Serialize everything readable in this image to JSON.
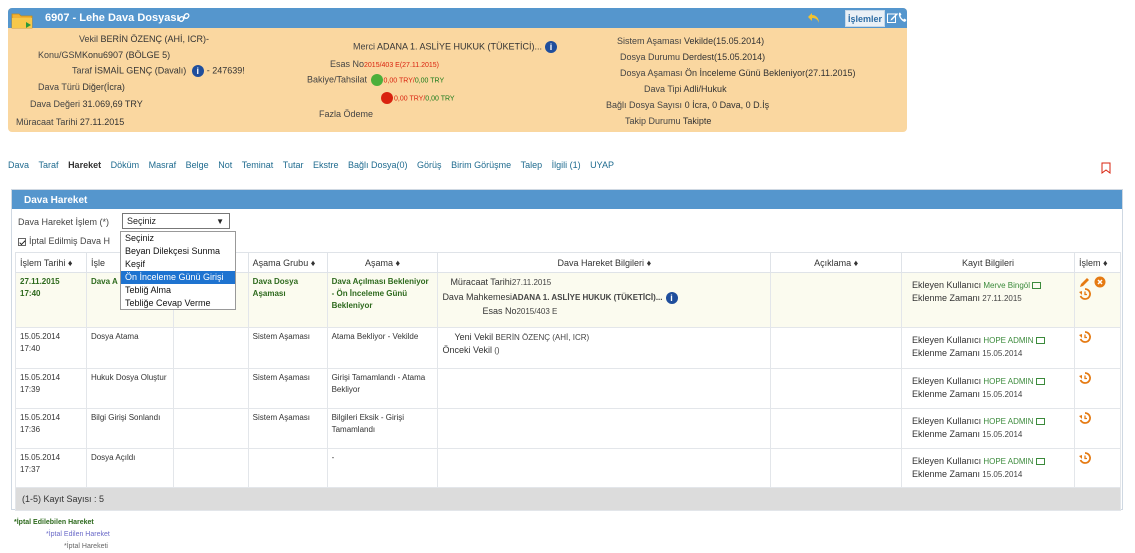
{
  "header": {
    "title": "6907 - Lehe Dava Dosyası",
    "actions_label": "İşlemler",
    "left": {
      "vekil": {
        "label": "Vekil",
        "value": "BERİN ÖZENÇ (AHİ, ICR)-"
      },
      "konu": {
        "label": "Konu/GSM",
        "value": "Konu6907 (BÖLGE 5)"
      },
      "taraf": {
        "label": "Taraf",
        "value": "İSMAİL GENÇ (Davalı)",
        "extra": "- 247639!"
      },
      "dava_turu": {
        "label": "Dava Türü",
        "value": "Diğer(İcra)"
      },
      "dava_degeri": {
        "label": "Dava Değeri",
        "value": "31.069,69 TRY"
      },
      "muracaat": {
        "label": "Müracaat Tarihi",
        "value": "27.11.2015"
      }
    },
    "middle": {
      "merci": {
        "label": "Merci",
        "value": "ADANA 1. ASLİYE HUKUK (TÜKETİCİ)..."
      },
      "esas": {
        "label": "Esas No",
        "value": "2015/403 E(27.11.2015)"
      },
      "bakiye": {
        "label": "Bakiye/Tahsilat",
        "line1": "0,00 TRY/",
        "line1b": "0,00 TRY",
        "line2": "0,00 TRY/",
        "line2b": "0,00 TRY"
      },
      "fazla": {
        "label": "Fazla Ödeme"
      }
    },
    "right": {
      "sistem": {
        "label": "Sistem Aşaması",
        "value": "Vekilde(15.05.2014)"
      },
      "durumu": {
        "label": "Dosya Durumu",
        "value": "Derdest(15.05.2014)"
      },
      "asamasi": {
        "label": "Dosya Aşaması",
        "value": "Ön İnceleme Günü Bekleniyor(27.11.2015)"
      },
      "tipi": {
        "label": "Dava Tipi",
        "value": "Adli/Hukuk"
      },
      "bagli": {
        "label": "Bağlı Dosya Sayısı",
        "value": "0 İcra, 0 Dava, 0 D.İş"
      },
      "takip": {
        "label": "Takip Durumu",
        "value": "Takipte"
      }
    }
  },
  "tabs": [
    "Dava",
    "Taraf",
    "Hareket",
    "Döküm",
    "Masraf",
    "Belge",
    "Not",
    "Teminat",
    "Tutar",
    "Ekstre",
    "Bağlı Dosya(0)",
    "Görüş",
    "Birim Görüşme",
    "Talep",
    "İlgili (1)",
    "UYAP"
  ],
  "active_tab": "Hareket",
  "panel": {
    "title": "Dava Hareket",
    "form_label": "Dava Hareket İşlem (*)",
    "select_value": "Seçiniz",
    "checkbox_label": "İptal Edilmiş Dava H",
    "dropdown": [
      "Seçiniz",
      "Beyan Dilekçesi Sunma",
      "Keşif",
      "Ön İnceleme Günü Girişi",
      "Tebliğ Alma",
      "Tebliğe Cevap Verme"
    ],
    "dropdown_selected": 3
  },
  "table": {
    "headers": [
      "İşlem Tarihi",
      "İşle",
      "",
      "Aşama Grubu",
      "Aşama",
      "Dava Hareket Bilgileri",
      "Açıklama",
      "Kayıt Bilgileri",
      "İşlem"
    ],
    "rows": [
      {
        "date": "27.11.2015",
        "time": "17:40",
        "islem": "Dava A",
        "grup": "Dava Dosya Aşaması",
        "asama": "Dava Açılması Bekleniyor - Ön İnceleme Günü Bekleniyor",
        "info": [
          {
            "k": "Müracaat Tarihi",
            "v": "27.11.2015"
          },
          {
            "k": "Dava Mahkemesi",
            "v": "ADANA 1. ASLİYE HUKUK (TÜKETİCİ)..."
          },
          {
            "k": "Esas No",
            "v": "2015/403 E"
          }
        ],
        "ekleyen": "Merve Bingöl",
        "zaman": "27.11.2015"
      },
      {
        "date": "15.05.2014",
        "time": "17:40",
        "islem": "Dosya Atama",
        "grup": "Sistem Aşaması",
        "asama": "Atama Bekliyor - Vekilde",
        "info": [
          {
            "k": "Yeni Vekil",
            "v": "BERİN ÖZENÇ (AHİ, ICR)"
          },
          {
            "k": "Önceki Vekil",
            "v": "()"
          }
        ],
        "ekleyen": "HOPE ADMIN",
        "zaman": "15.05.2014"
      },
      {
        "date": "15.05.2014",
        "time": "17:39",
        "islem": "Hukuk Dosya Oluştur",
        "grup": "Sistem Aşaması",
        "asama": "Girişi Tamamlandı - Atama Bekliyor",
        "info": [],
        "ekleyen": "HOPE ADMIN",
        "zaman": "15.05.2014"
      },
      {
        "date": "15.05.2014",
        "time": "17:36",
        "islem": "Bilgi Girişi Sonlandı",
        "grup": "Sistem Aşaması",
        "asama": "Bilgileri Eksik - Girişi Tamamlandı",
        "info": [],
        "ekleyen": "HOPE ADMIN",
        "zaman": "15.05.2014"
      },
      {
        "date": "15.05.2014",
        "time": "17:37",
        "islem": "Dosya Açıldı",
        "grup": "",
        "asama": "-",
        "info": [],
        "ekleyen": "HOPE ADMIN",
        "zaman": "15.05.2014"
      }
    ],
    "kayit_labels": {
      "ekleyen": "Ekleyen Kullanıcı",
      "zaman": "Eklenme Zamanı"
    },
    "footer": "(1-5) Kayıt Sayısı : 5"
  },
  "legend": {
    "l1": "*İptal Edilebilen Hareket",
    "l2": "*İptal Edilen Hareket",
    "l3": "*İptal Hareketi"
  },
  "colors": {
    "header_bar": "#5596cd",
    "card_bg": "#fad7a0",
    "selected": "#1e73d0",
    "green": "#2e6a1e"
  }
}
